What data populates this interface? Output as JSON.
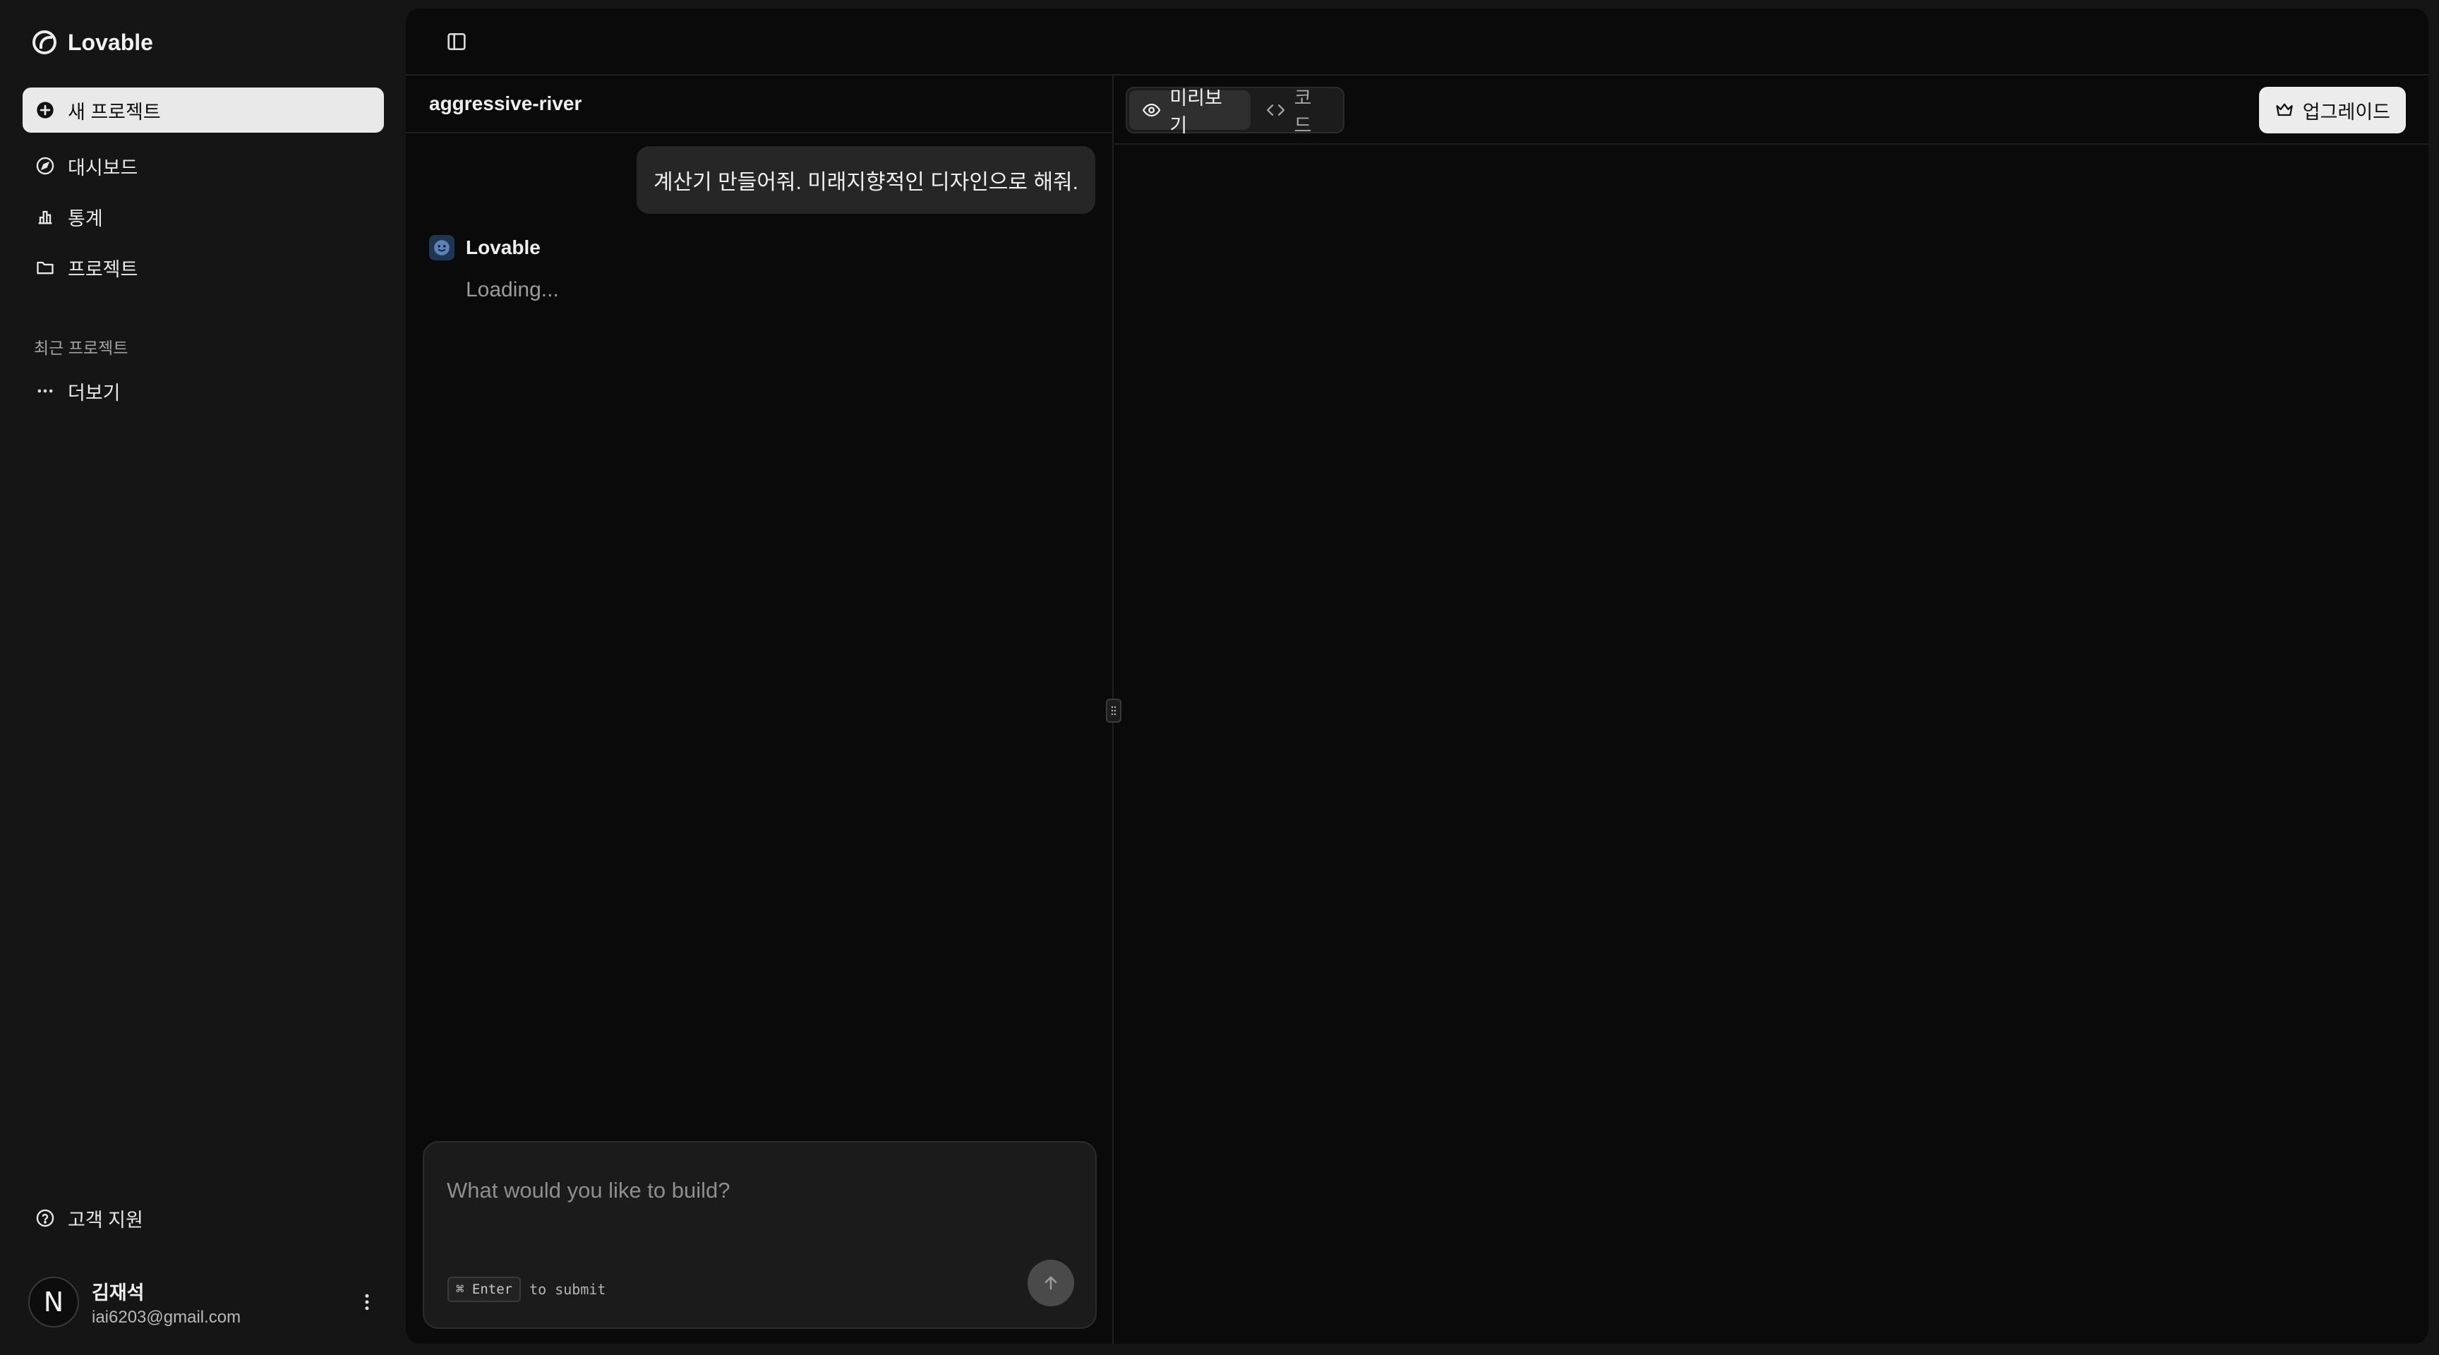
{
  "app": {
    "brand": "Lovable"
  },
  "sidebar": {
    "items": [
      {
        "label": "새 프로젝트",
        "icon": "plus-circle-icon",
        "active": true
      },
      {
        "label": "대시보드",
        "icon": "compass-icon"
      },
      {
        "label": "통계",
        "icon": "bar-chart-icon"
      },
      {
        "label": "프로젝트",
        "icon": "folder-icon"
      }
    ],
    "recent_label": "최근 프로젝트",
    "more_label": "더보기",
    "support_label": "고객 지원"
  },
  "user": {
    "initial": "N",
    "name": "김재석",
    "email": "iai6203@gmail.com"
  },
  "chat": {
    "project_name": "aggressive-river",
    "user_message": "계산기 만들어줘. 미래지향적인 디자인으로 해줘.",
    "assistant_name": "Lovable",
    "loading_text": "Loading...",
    "placeholder": "What would you like to build?",
    "hint_key": "⌘ Enter",
    "hint_text": "to submit"
  },
  "preview": {
    "tabs": [
      {
        "label": "미리보기",
        "icon": "eye-icon",
        "active": true
      },
      {
        "label": "코드",
        "icon": "code-icon"
      }
    ],
    "upgrade_label": "업그레이드"
  },
  "colors": {
    "background": "#151515",
    "panel": "#0a0a0a",
    "active_item": "#e9e9e9",
    "bubble": "#262626"
  }
}
